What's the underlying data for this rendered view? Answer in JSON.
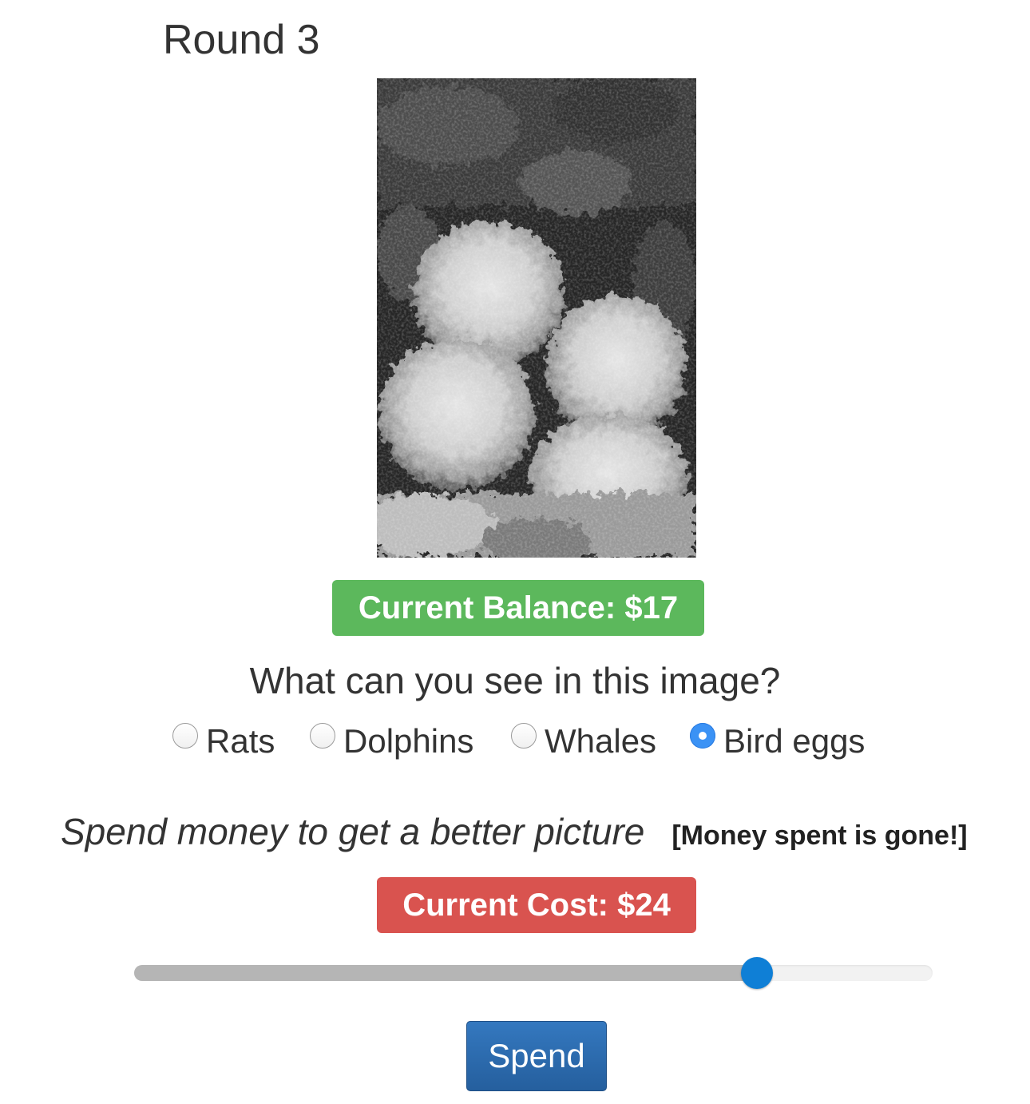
{
  "round": {
    "title": "Round 3"
  },
  "image": {
    "alt": "Blurred grayscale picture"
  },
  "balance": {
    "label": "Current Balance: $17",
    "color": "#5cb85c"
  },
  "question": {
    "text": "What can you see in this image?"
  },
  "options": [
    {
      "label": "Rats",
      "checked": false
    },
    {
      "label": "Dolphins",
      "checked": false
    },
    {
      "label": "Whales",
      "checked": false
    },
    {
      "label": "Bird eggs",
      "checked": true
    }
  ],
  "spend": {
    "heading": "Spend money to get a better picture",
    "warning": "[Money spent is gone!]"
  },
  "cost": {
    "label": "Current Cost: $24",
    "color": "#d9534f"
  },
  "slider": {
    "value": 0.78,
    "accent": "#0f7fd6"
  },
  "button": {
    "label": "Spend",
    "color": "#2f6fb0"
  }
}
